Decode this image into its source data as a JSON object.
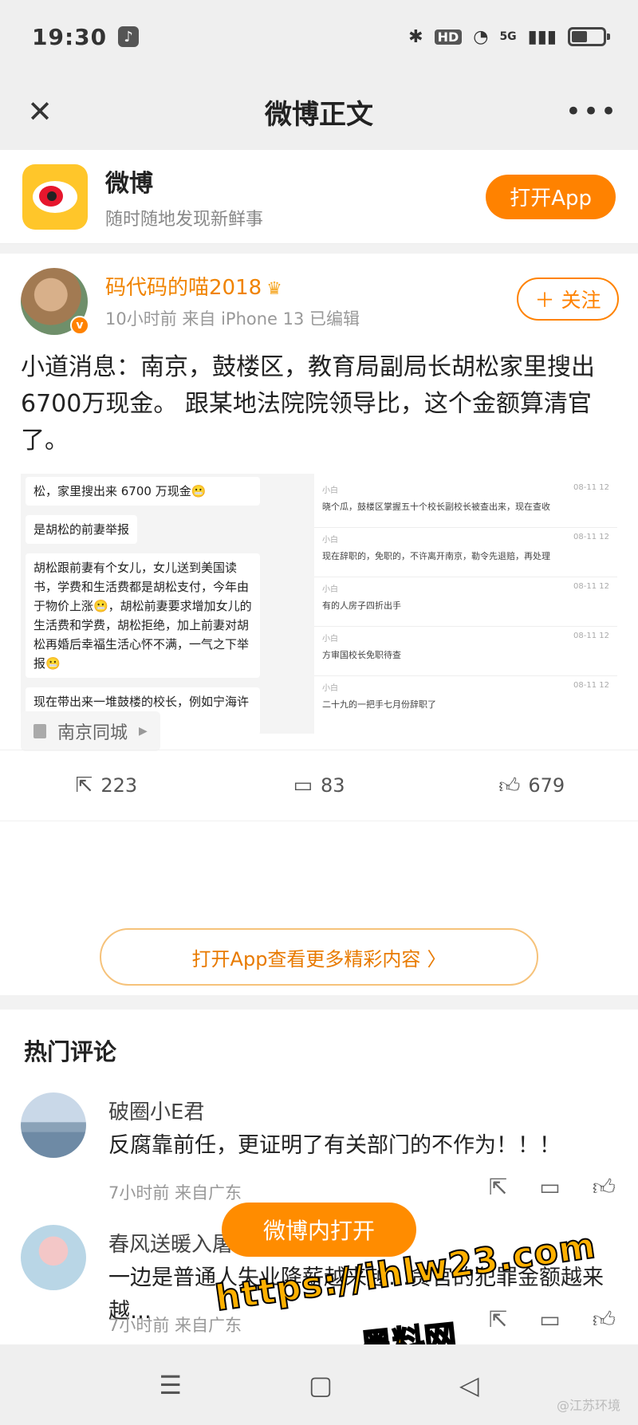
{
  "status_bar": {
    "time": "19:30",
    "tiktok_icon": "tiktok-icon",
    "bluetooth": "✱",
    "hd": "HD",
    "wifi": "wifi-icon",
    "network": "5G",
    "battery_level": 0.5
  },
  "nav": {
    "close_icon": "close-icon",
    "title": "微博正文",
    "more_icon": "more-icon"
  },
  "banner": {
    "title": "微博",
    "subtitle": "随时随地发现新鲜事",
    "open_button": "打开App"
  },
  "post": {
    "author": "码代码的喵2018",
    "meta": "10小时前  来自 iPhone 13 已编辑",
    "follow_label": "关注",
    "text": "小道消息：南京，鼓楼区，教育局副局长胡松家里搜出6700万现金。 跟某地法院院领导比，这个金额算清官了。",
    "image_left": [
      "松，家里搜出来 6700 万现金😬",
      "是胡松的前妻举报",
      "胡松跟前妻有个女儿，女儿送到美国读书，学费和生活费都是胡松支付，今年由于物价上涨😬，胡松前妻要求增加女儿的生活费和学费，胡松拒绝，加上前妻对胡松再婚后幸福生活心怀不满，一气之下举报😬",
      "现在带出来一堆鼓楼的校长，例如宁海许天柩等若干人"
    ],
    "image_right": [
      {
        "who": "小白",
        "time": "08-11 12",
        "msg": "晓个瓜，鼓楼区掌握五十个校长副校长被查出来，现在查收"
      },
      {
        "who": "小白",
        "time": "08-11 12",
        "msg": "现在辞职的，免职的，不许离开南京，勒令先退赔，再处理"
      },
      {
        "who": "小白",
        "time": "08-11 12",
        "msg": "有的人房子四折出手"
      },
      {
        "who": "小白",
        "time": "08-11 12",
        "msg": "方审国校长免职待查"
      },
      {
        "who": "小白",
        "time": "08-11 12",
        "msg": "二十九的一把手七月份辞职了"
      }
    ],
    "location": "南京同城",
    "reposts": "223",
    "comments": "83",
    "likes": "679"
  },
  "more_button": "打开App查看更多精彩内容",
  "hot_comments": {
    "title": "热门评论",
    "items": [
      {
        "name": "破圈小E君",
        "text": "反腐靠前任，更证明了有关部门的不作为！！！",
        "meta": "7小时前 来自广东"
      },
      {
        "name": "春风送暖入屠",
        "text": "一边是普通人失业降薪越来越…贪官的犯罪金额越来越…",
        "meta": "7小时前 来自广东"
      }
    ]
  },
  "float_open": "微博内打开",
  "watermark": {
    "line1": "https://ihlw23.com",
    "line2": "黑料网"
  },
  "system_nav": {
    "menu": "☰",
    "home": "▢",
    "back": "◁"
  },
  "corner_mark": "@江苏环境"
}
